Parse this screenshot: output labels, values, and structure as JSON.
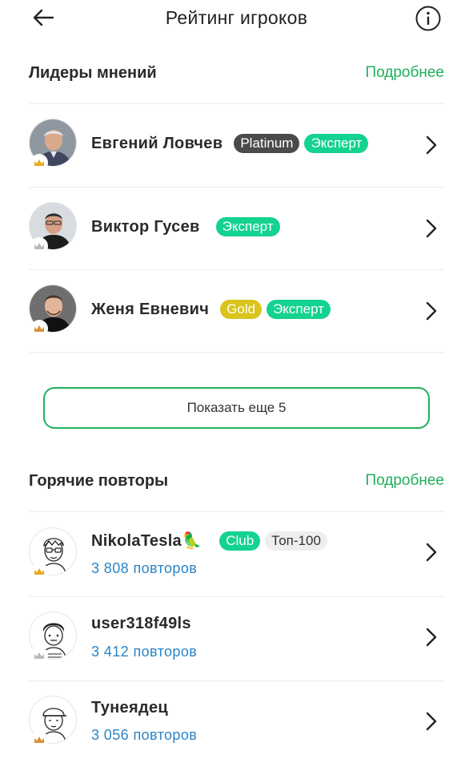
{
  "header": {
    "title": "Рейтинг игроков",
    "back_icon": "arrow-left-icon",
    "info_icon": "info-icon"
  },
  "leaders": {
    "title": "Лидеры мнений",
    "more_label": "Подробнее",
    "items": [
      {
        "name": "Евгений Ловчев",
        "badges": [
          "Platinum",
          "Эксперт"
        ],
        "crown": "gold"
      },
      {
        "name": "Виктор Гусев",
        "badges": [
          "Эксперт"
        ],
        "crown": "silver"
      },
      {
        "name": "Женя Евневич",
        "badges": [
          "Gold",
          "Эксперт"
        ],
        "crown": "bronze"
      }
    ],
    "show_more_label": "Показать еще 5"
  },
  "hot": {
    "title": "Горячие повторы",
    "more_label": "Подробнее",
    "items": [
      {
        "name": "NikolaTesla🦜",
        "badges": [
          "Club",
          "Топ-100"
        ],
        "repeats": "3 808 повторов",
        "crown": "gold"
      },
      {
        "name": "user318f49ls",
        "badges": [],
        "repeats": "3 412 повторов",
        "crown": "silver"
      },
      {
        "name": "Тунеядец",
        "badges": [],
        "repeats": "3 056 повторов",
        "crown": "bronze"
      }
    ]
  },
  "colors": {
    "accent_green": "#1fb05c",
    "expert_badge": "#14d28f",
    "platinum_badge": "#4a4a4a",
    "gold_badge": "#d9c41c",
    "repeats_text": "#2a84c8"
  }
}
